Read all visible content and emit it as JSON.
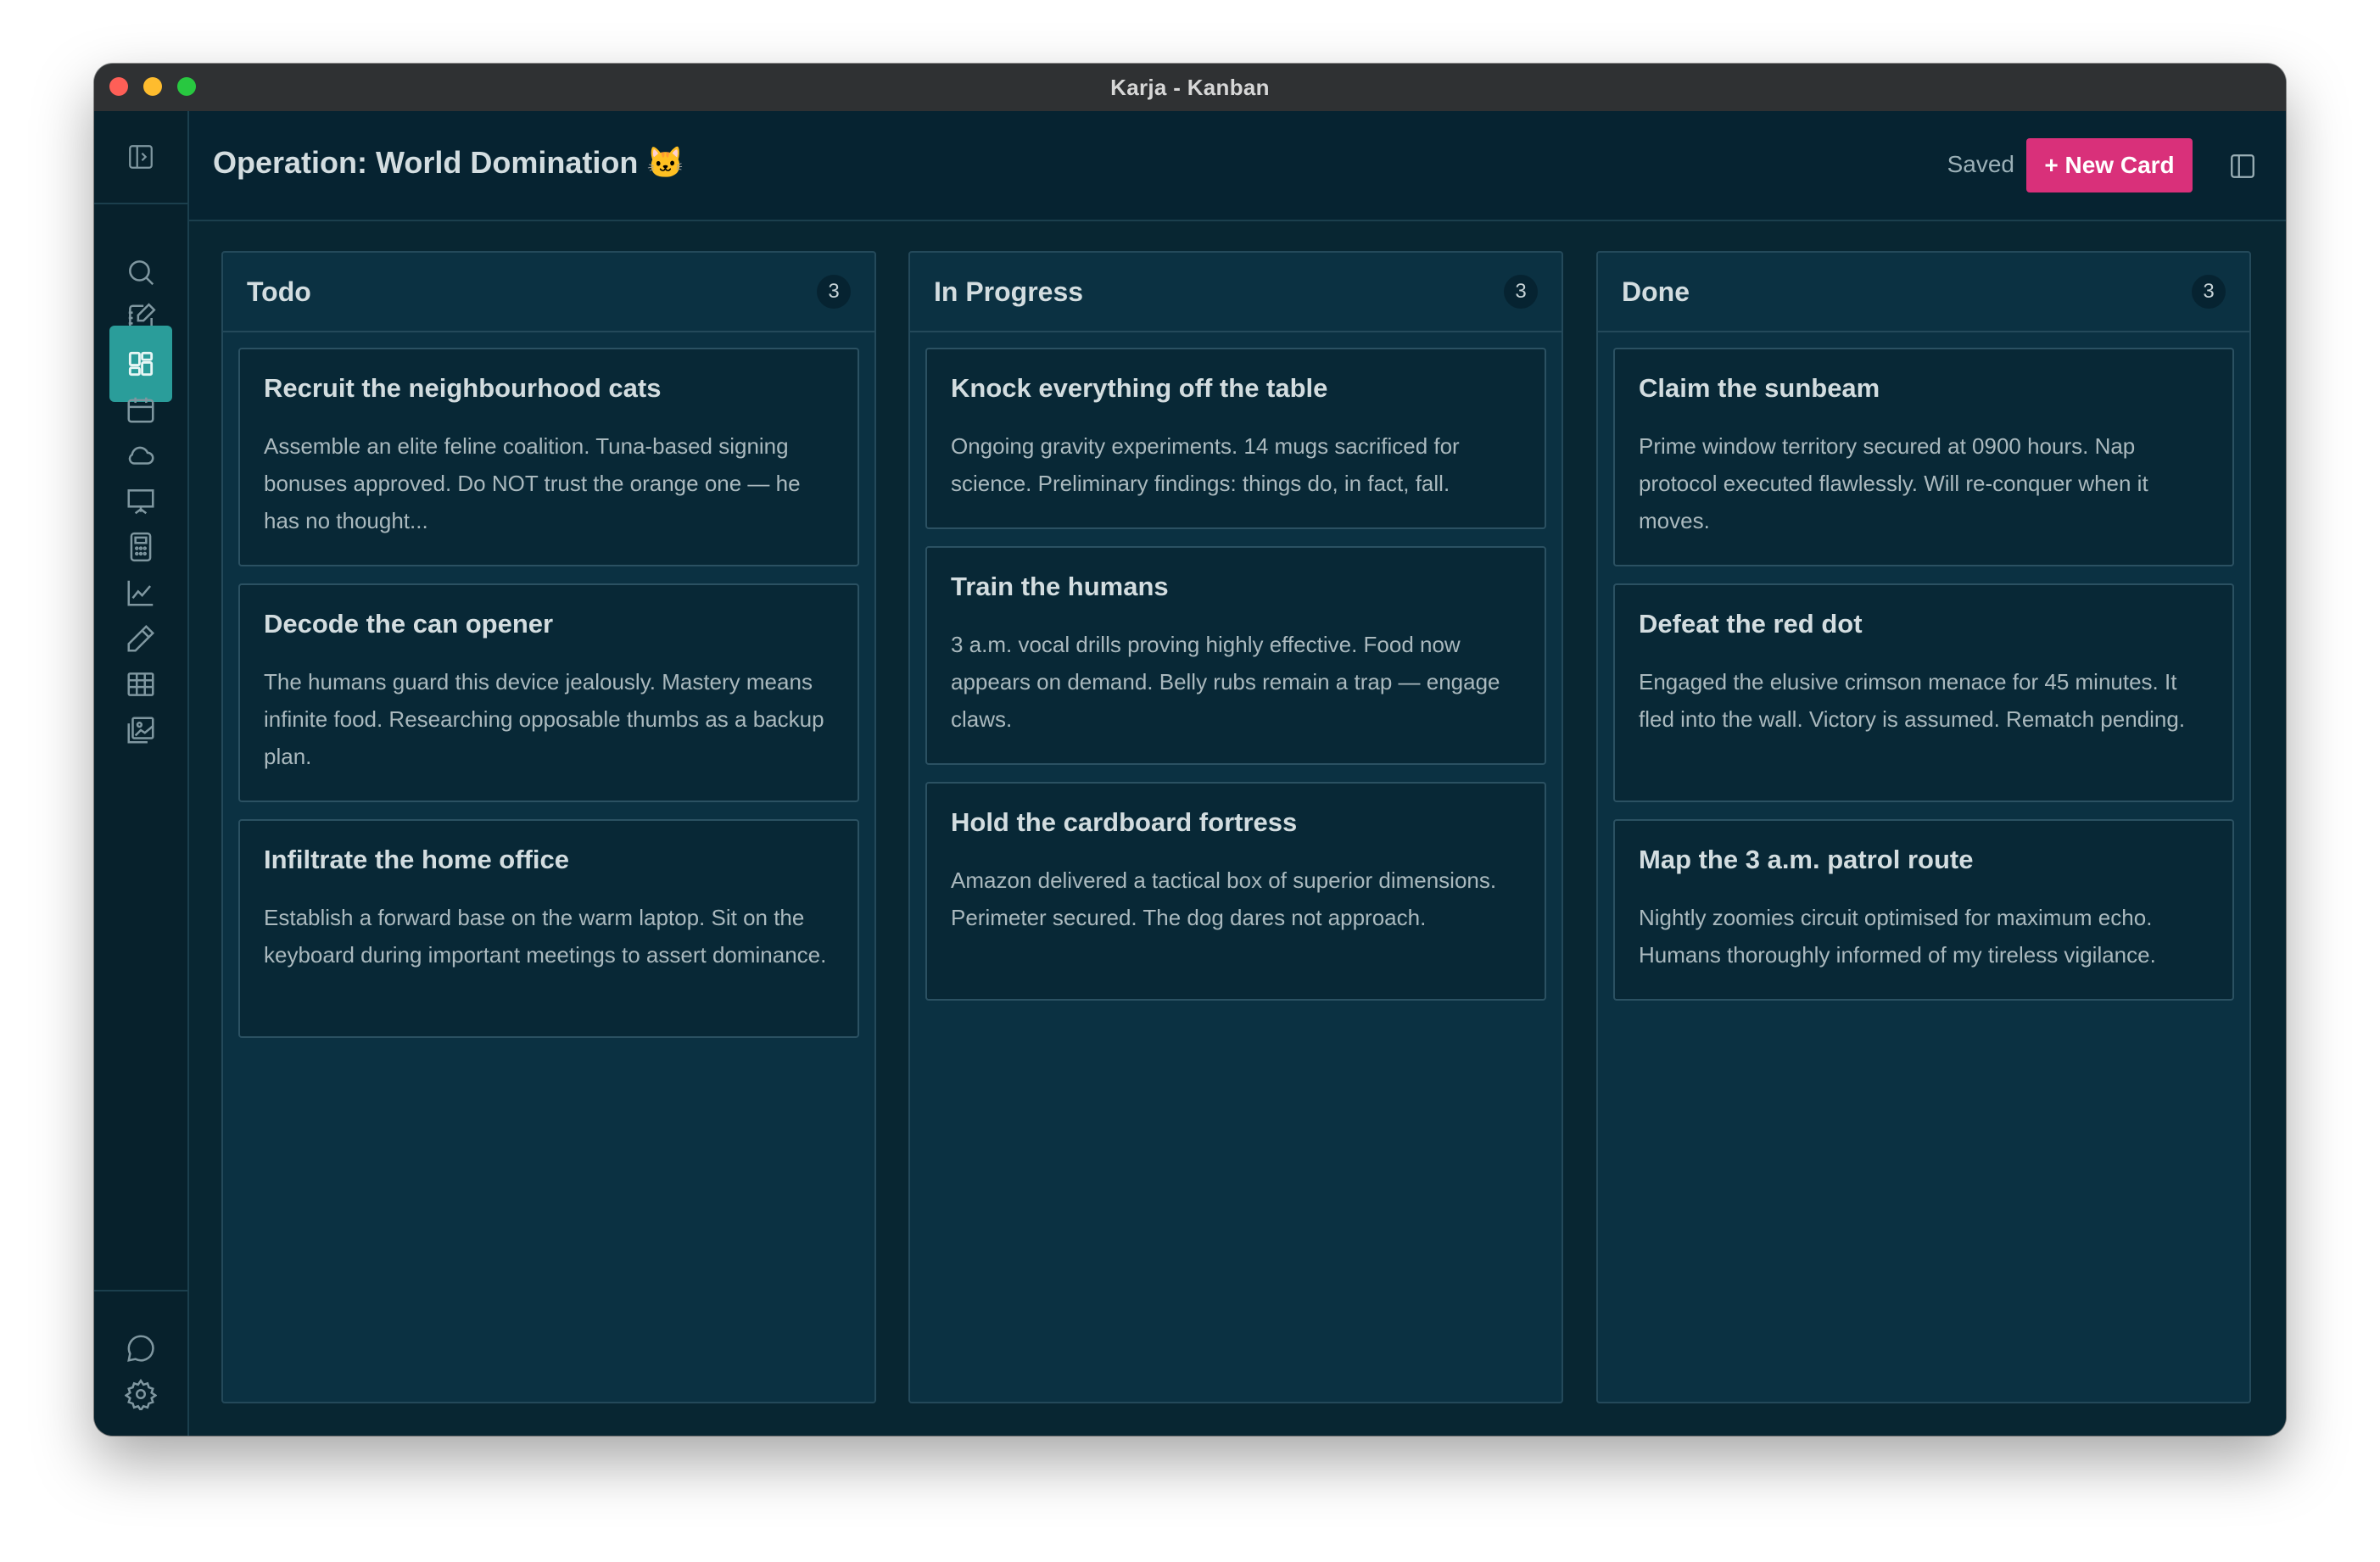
{
  "window": {
    "title": "Karja - Kanban"
  },
  "header": {
    "title": "Operation: World Domination 🐱",
    "status": "Saved",
    "new_card_label": "+ New Card"
  },
  "sidebar": {
    "items": [
      {
        "icon": "search-icon"
      },
      {
        "icon": "notes-icon"
      },
      {
        "icon": "kanban-icon",
        "active": true
      },
      {
        "icon": "calendar-icon"
      },
      {
        "icon": "cloud-icon"
      },
      {
        "icon": "presentation-icon"
      },
      {
        "icon": "calculator-icon"
      },
      {
        "icon": "chart-icon"
      },
      {
        "icon": "pencil-icon"
      },
      {
        "icon": "table-icon"
      },
      {
        "icon": "gallery-icon"
      }
    ],
    "bottom": [
      {
        "icon": "chat-icon"
      },
      {
        "icon": "settings-icon"
      }
    ]
  },
  "columns": [
    {
      "title": "Todo",
      "count": "3",
      "cards": [
        {
          "title": "Recruit the neighbourhood cats",
          "body": "Assemble an elite feline coalition. Tuna-based signing bonuses approved. Do NOT trust the orange one — he has no thought..."
        },
        {
          "title": "Decode the can opener",
          "body": "The humans guard this device jealously. Mastery means infinite food. Researching opposable thumbs as a backup plan."
        },
        {
          "title": "Infiltrate the home office",
          "body": "Establish a forward base on the warm laptop. Sit on the keyboard during important meetings to assert dominance."
        }
      ]
    },
    {
      "title": "In Progress",
      "count": "3",
      "cards": [
        {
          "title": "Knock everything off the table",
          "body": "Ongoing gravity experiments. 14 mugs sacrificed for science. Preliminary findings: things do, in fact, fall."
        },
        {
          "title": "Train the humans",
          "body": "3 a.m. vocal drills proving highly effective. Food now appears on demand. Belly rubs remain a trap — engage claws."
        },
        {
          "title": "Hold the cardboard fortress",
          "body": "Amazon delivered a tactical box of superior dimensions. Perimeter secured. The dog dares not approach."
        }
      ]
    },
    {
      "title": "Done",
      "count": "3",
      "cards": [
        {
          "title": "Claim the sunbeam",
          "body": "Prime window territory secured at 0900 hours. Nap protocol executed flawlessly. Will re-conquer when it moves."
        },
        {
          "title": "Defeat the red dot",
          "body": "Engaged the elusive crimson menace for 45 minutes. It fled into the wall. Victory is assumed. Rematch pending."
        },
        {
          "title": "Map the 3 a.m. patrol route",
          "body": "Nightly zoomies circuit optimised for maximum echo. Humans thoroughly informed of my tireless vigilance."
        }
      ]
    }
  ]
}
